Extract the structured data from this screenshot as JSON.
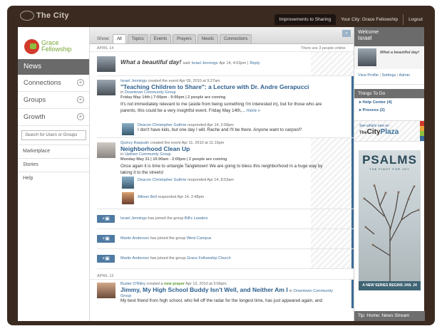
{
  "app": {
    "brand": "The City"
  },
  "topnav": {
    "improvements": "Improvements to Sharing",
    "your_city": "Your City: Grace Fellowship",
    "logout": "Logout"
  },
  "sidebar": {
    "church_line1": "Grace",
    "church_line2": "Fellowship",
    "news": "News",
    "items": [
      {
        "label": "Connections"
      },
      {
        "label": "Groups"
      },
      {
        "label": "Growth"
      }
    ],
    "search_placeholder": "Search for Users or Groups",
    "links": [
      {
        "label": "Marketplace"
      },
      {
        "label": "Stories"
      },
      {
        "label": "Help"
      }
    ]
  },
  "filters": {
    "show_label": "Show:",
    "tabs": [
      "All",
      "Topics",
      "Events",
      "Prayers",
      "Needs",
      "Connections"
    ],
    "active": "All"
  },
  "feed": {
    "date1": "APRIL 14",
    "online": "There are 3 people online.",
    "status": {
      "quote": "What a beautiful day!",
      "said": "said",
      "author": "Israel Jennings",
      "time": "Apr 14, 4:53pm",
      "sep": "|",
      "reply": "Reply"
    },
    "event1": {
      "author": "Israel Jennings",
      "action": "created the event Apr 09, 2010 at 9:27am",
      "title": "\"Teaching Children to Share\": a Lecture with Dr. Andre Gerapucci",
      "in_label": "in",
      "group": "Downtown Community Group",
      "when": "Friday May 14th | 7:00pm - 9:00pm | 2 people are coming",
      "body": "It's not immediately relevant to me (aside from being something I'm interested in), but for those who are parents, this could be a very insightful event. Friday May 14th,...",
      "more": "more »",
      "reply_author": "Deacon Christopher Guthrie",
      "reply_meta": "responded Apr 14, 2:58pm",
      "reply_text": "I don't have kids, but one day I will. Rache and I'll be there. Anyone want to carpool?"
    },
    "event2": {
      "author": "Quincy Rasputin",
      "action": "created the event Apr 11, 2010 at 11:19pm",
      "title": "Neighborhood Clean Up",
      "in_label": "in",
      "group": "Uptown Community Group",
      "when": "Monday May 31 | 10:00am - 2:00pm | 2 people are coming",
      "body": "Once again it is time to untangle Tangletown! We are going to bless this neighborhood in a huge way by taking it to the streets!",
      "reply1_author": "Deacon Christopher Guthrie",
      "reply1_meta": "responded Apr 14, 8:53am",
      "reply2_author": "Allison Bell",
      "reply2_meta": "responded Apr 14, 2:48pm"
    },
    "joins": [
      {
        "person": "Israel Jennings",
        "text": "has joined the group",
        "group": "Bill's Leaders"
      },
      {
        "person": "Martin Anderson",
        "text": "has joined the group",
        "group": "West Campus"
      },
      {
        "person": "Martin Anderson",
        "text": "has joined the group",
        "group": "Grace Fellowship Church"
      }
    ],
    "date2": "APRIL 13",
    "prayer": {
      "author": "Buster O'Riley",
      "action_pre": "created a",
      "kind": "new prayer",
      "action_post": "Apr 13, 2010 at 3:56pm",
      "title": "Jimmy, My High School Buddy Isn't Well, and Neither Am I",
      "in_label": "in",
      "group": "Downtown Community Group",
      "body": "My best friend from high school, who fell off the radar for the longest time, has just appeared again, and"
    }
  },
  "right": {
    "welcome": "Welcome",
    "user": "Israel",
    "expand": "»",
    "status": "What a beautiful day!",
    "links": {
      "profile": "View Profile",
      "settings": "Settings",
      "admin": "Admin",
      "sep": "|"
    },
    "todo_title": "Things To Do",
    "todos": [
      {
        "label": "Help Center (4)"
      },
      {
        "label": "Process (2)"
      }
    ],
    "plaza_line1": "See what's new on",
    "plaza_the": "The",
    "plaza_city": "City",
    "plaza_plaza": "Plaza",
    "poster": {
      "title": "PSALMS",
      "subtitle": "THE FIGHT FOR JOY",
      "banner": "A NEW SERIES BEGINS JAN. 24"
    },
    "tip": "Tip: Home: News Stream"
  }
}
